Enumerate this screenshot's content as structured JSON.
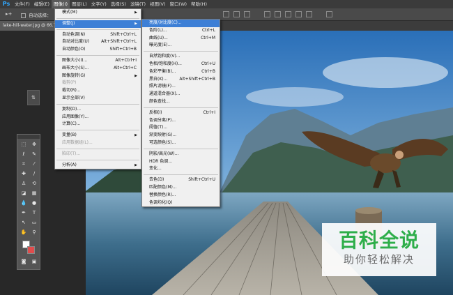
{
  "app": {
    "logo": "Ps"
  },
  "menubar": {
    "items": [
      "文件(F)",
      "编辑(E)",
      "图像(I)",
      "图层(L)",
      "文字(Y)",
      "选择(S)",
      "滤镜(T)",
      "视图(V)",
      "窗口(W)",
      "帮助(H)"
    ],
    "active_index": 2
  },
  "options": {
    "tool_glyph": "▸+",
    "auto_select": "自动选择："
  },
  "document": {
    "tab": "lake-hill-water.jpg @ 66.7"
  },
  "image_menu": {
    "items": [
      {
        "label": "模式(M)",
        "submenu": true
      },
      {
        "sep": true
      },
      {
        "label": "调整(J)",
        "submenu": true,
        "highlight": true
      },
      {
        "sep": true
      },
      {
        "label": "自动色调(N)",
        "shortcut": "Shift+Ctrl+L"
      },
      {
        "label": "自动对比度(U)",
        "shortcut": "Alt+Shift+Ctrl+L"
      },
      {
        "label": "自动颜色(O)",
        "shortcut": "Shift+Ctrl+B"
      },
      {
        "sep": true
      },
      {
        "label": "图像大小(I)...",
        "shortcut": "Alt+Ctrl+I"
      },
      {
        "label": "画布大小(S)...",
        "shortcut": "Alt+Ctrl+C"
      },
      {
        "label": "图像旋转(G)",
        "submenu": true
      },
      {
        "label": "裁剪(P)",
        "disabled": true
      },
      {
        "label": "裁切(R)..."
      },
      {
        "label": "显示全部(V)"
      },
      {
        "sep": true
      },
      {
        "label": "复制(D)..."
      },
      {
        "label": "应用图像(Y)..."
      },
      {
        "label": "计算(C)..."
      },
      {
        "sep": true
      },
      {
        "label": "变量(B)",
        "submenu": true
      },
      {
        "label": "应用数据组(L)...",
        "disabled": true
      },
      {
        "sep": true
      },
      {
        "label": "陷印(T)...",
        "disabled": true
      },
      {
        "sep": true
      },
      {
        "label": "分析(A)",
        "submenu": true
      }
    ]
  },
  "adjust_menu": {
    "items": [
      {
        "label": "亮度/对比度(C)...",
        "highlight": true
      },
      {
        "label": "色阶(L)...",
        "shortcut": "Ctrl+L"
      },
      {
        "label": "曲线(U)...",
        "shortcut": "Ctrl+M"
      },
      {
        "label": "曝光度(E)..."
      },
      {
        "sep": true
      },
      {
        "label": "自然饱和度(V)..."
      },
      {
        "label": "色相/饱和度(H)...",
        "shortcut": "Ctrl+U"
      },
      {
        "label": "色彩平衡(B)...",
        "shortcut": "Ctrl+B"
      },
      {
        "label": "黑白(K)...",
        "shortcut": "Alt+Shift+Ctrl+B"
      },
      {
        "label": "照片滤镜(F)..."
      },
      {
        "label": "通道混合器(X)..."
      },
      {
        "label": "颜色查找..."
      },
      {
        "sep": true
      },
      {
        "label": "反相(I)",
        "shortcut": "Ctrl+I"
      },
      {
        "label": "色调分离(P)..."
      },
      {
        "label": "阈值(T)..."
      },
      {
        "label": "渐变映射(G)..."
      },
      {
        "label": "可选颜色(S)..."
      },
      {
        "sep": true
      },
      {
        "label": "阴影/高光(W)..."
      },
      {
        "label": "HDR 色调..."
      },
      {
        "label": "变化..."
      },
      {
        "sep": true
      },
      {
        "label": "去色(D)",
        "shortcut": "Shift+Ctrl+U"
      },
      {
        "label": "匹配颜色(M)..."
      },
      {
        "label": "替换颜色(R)..."
      },
      {
        "label": "色调均化(Q)"
      }
    ]
  },
  "watermark": {
    "title": "百科全说",
    "subtitle": "助你轻松解决"
  },
  "colors": {
    "accent": "#3d7fd6",
    "foreground": "#ffffff",
    "background": "#e04c4c"
  }
}
